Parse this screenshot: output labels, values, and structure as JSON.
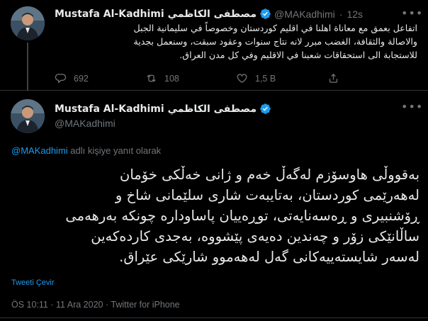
{
  "tweets": [
    {
      "author_name": "Mustafa Al-Kadhimi مصطفى الكاظمي",
      "handle": "@MAKadhimi",
      "time": "12s",
      "text_lines": [
        "اتفاعل بعمق مع معاناة اهلنا في اقليم كوردستان وخصوصاً في سليمانية الجبل",
        "والاصالة والثقافة، الغضب مبرر لانه نتاج سنوات وعقود سبقت، وسنعمل بجدية",
        "للاستجابة الى استحقاقات شعبنا في الاقليم وفي كل مدن العراق."
      ],
      "stats": {
        "replies": "692",
        "retweets": "108",
        "likes": "1,5 B"
      }
    },
    {
      "author_name": "Mustafa Al-Kadhimi مصطفى الكاظمي",
      "handle": "@MAKadhimi",
      "replying_mention": "@MAKadhimi",
      "replying_suffix": " adlı kişiye yanıt olarak",
      "text_lines": [
        "بەقووڵی هاوسۆزم لەگەڵ خەم و ژانی خەڵکی خۆمان",
        "لەهەرێمی کوردستان، بەتایبەت شاری سلێمانی شاخ و",
        "ڕۆشنبیری و ڕەسەنایەتی، توڕەییان پاساودارە چونکە بەرهەمی",
        "ساڵانێکی زۆر و چەندین دەیەی پێشووە، بەجدی کاردەکەین",
        "لەسەر شایستەییەکانی گەل لەهەموو شارێکی عێراق."
      ],
      "translate_label": "Tweeti Çevir",
      "timestamp": "ÖS 10:11 · 11 Ara 2020 · Twitter for iPhone"
    }
  ],
  "icons": {
    "verified": "verified-badge-icon",
    "reply": "reply-icon",
    "retweet": "retweet-icon",
    "like": "heart-icon",
    "share": "share-icon",
    "more": "more-icon"
  },
  "colors": {
    "background": "#000000",
    "text": "#e7e9ea",
    "muted": "#71767b",
    "accent": "#1d9bf0",
    "divider": "#2f3336"
  }
}
